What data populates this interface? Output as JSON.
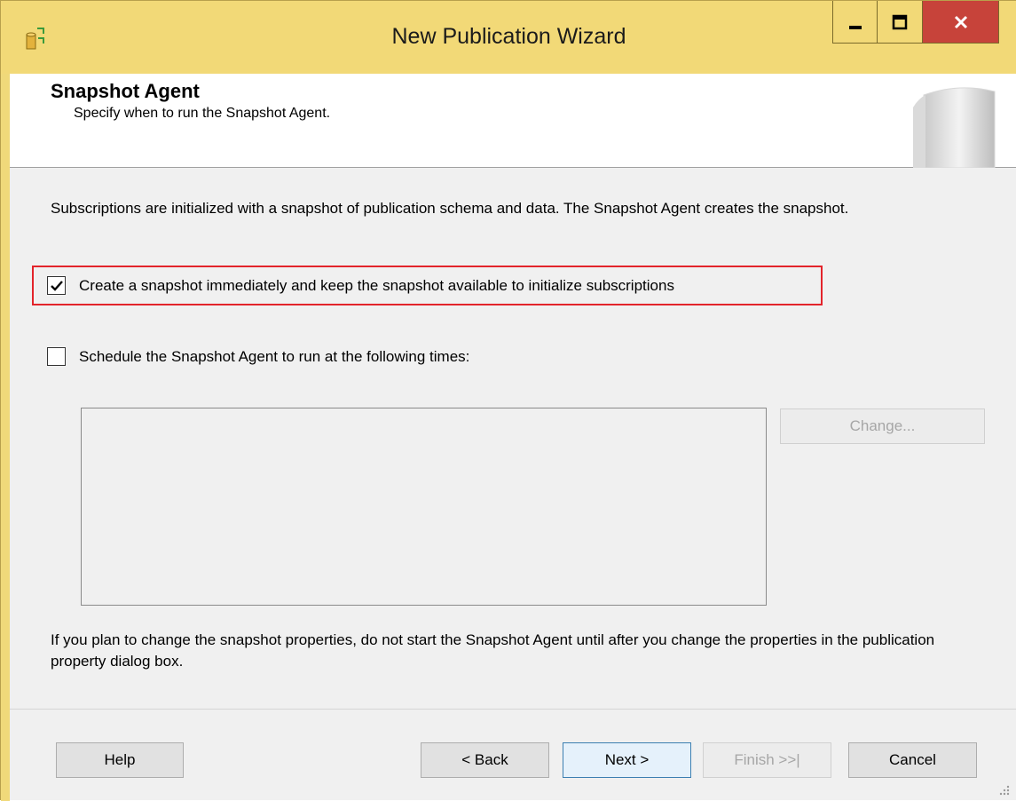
{
  "window": {
    "title": "New Publication Wizard",
    "controls": {
      "minimize": "minimize-icon",
      "maximize": "maximize-icon",
      "close": "close-icon"
    }
  },
  "header": {
    "title": "Snapshot Agent",
    "subtitle": "Specify when to run the Snapshot Agent."
  },
  "description": "Subscriptions are initialized with a snapshot of publication schema and data. The Snapshot Agent creates the snapshot.",
  "options": {
    "create_snapshot": {
      "label": "Create a snapshot immediately and keep the snapshot available to initialize subscriptions",
      "checked": true
    },
    "schedule_agent": {
      "label": "Schedule the Snapshot Agent to run at the following times:",
      "checked": false
    }
  },
  "schedule": {
    "change_button": "Change..."
  },
  "note": "If you plan to change the snapshot properties, do not start the Snapshot Agent until after you change the properties in the publication property dialog box.",
  "buttons": {
    "help": "Help",
    "back": "< Back",
    "next": "Next >",
    "finish": "Finish >>|",
    "cancel": "Cancel"
  },
  "colors": {
    "titlebar": "#f2d977",
    "close": "#c7433a",
    "highlight": "#e3242b"
  }
}
